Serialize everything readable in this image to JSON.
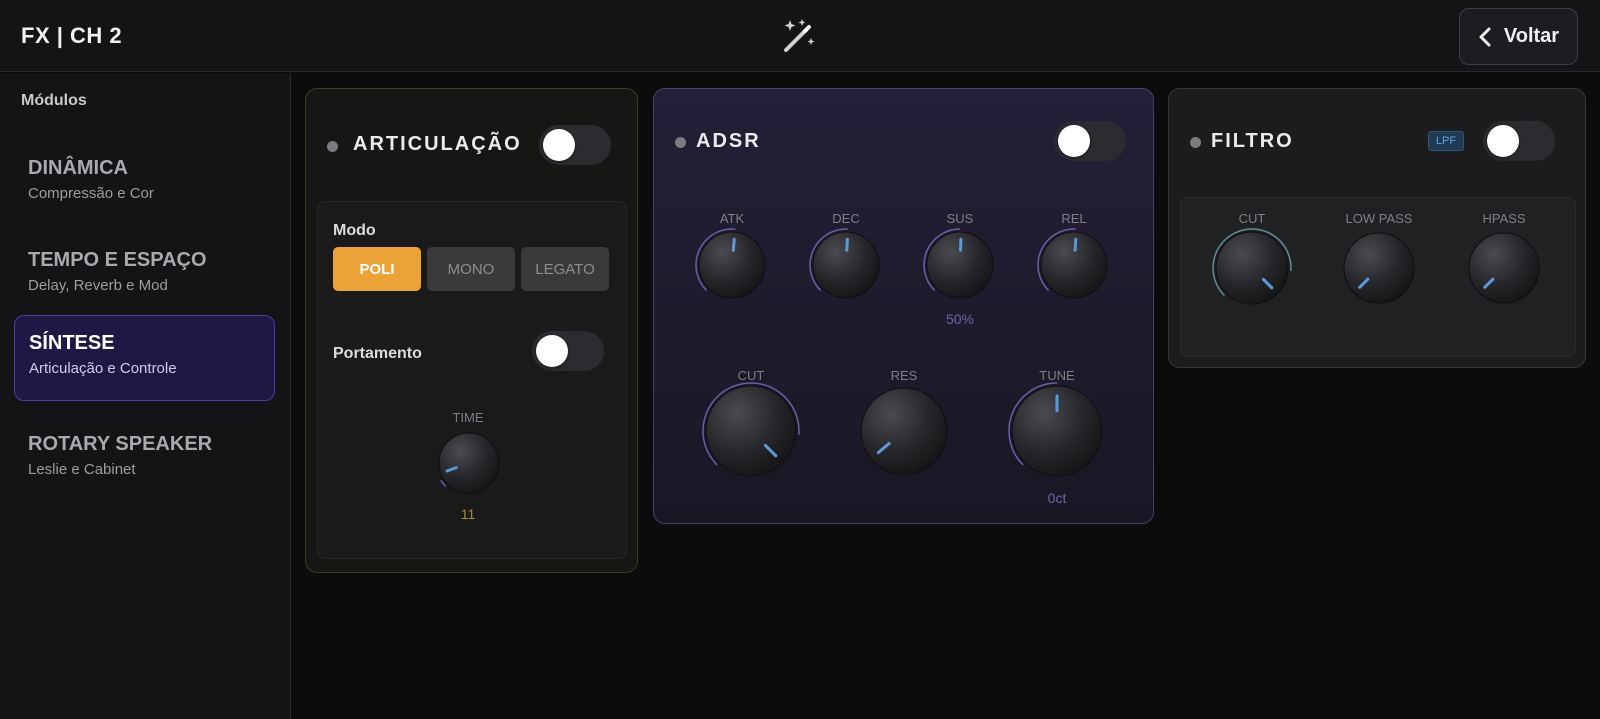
{
  "header": {
    "title": "FX | CH 2",
    "back_label": "Voltar"
  },
  "sidebar": {
    "heading": "Módulos",
    "items": [
      {
        "label": "DINÂMICA",
        "sub": "Compressão e Cor",
        "active": false
      },
      {
        "label": "TEMPO E ESPAÇO",
        "sub": "Delay, Reverb e Mod",
        "active": false
      },
      {
        "label": "SÍNTESE",
        "sub": "Articulação e Controle",
        "active": true
      },
      {
        "label": "ROTARY SPEAKER",
        "sub": "Leslie e Cabinet",
        "active": false
      }
    ]
  },
  "articulacao": {
    "title": "ARTICULAÇÃO",
    "enabled": false,
    "modo_label": "Modo",
    "modes": [
      "POLI",
      "MONO",
      "LEGATO"
    ],
    "selected_mode": "POLI",
    "portamento_label": "Portamento",
    "portamento_enabled": false,
    "time": {
      "label": "TIME",
      "value": "11"
    }
  },
  "adsr": {
    "title": "ADSR",
    "enabled": false,
    "knobs": [
      {
        "label": "ATK",
        "value": ""
      },
      {
        "label": "DEC",
        "value": ""
      },
      {
        "label": "SUS",
        "value": "50%"
      },
      {
        "label": "REL",
        "value": ""
      }
    ],
    "knobs_bottom": [
      {
        "label": "CUT",
        "value": ""
      },
      {
        "label": "RES",
        "value": ""
      },
      {
        "label": "TUNE",
        "value": "0ct"
      }
    ]
  },
  "filtro": {
    "title": "FILTRO",
    "badge": "LPF",
    "enabled": false,
    "knobs": [
      {
        "label": "CUT"
      },
      {
        "label": "LOW PASS"
      },
      {
        "label": "HPASS"
      }
    ]
  },
  "colors": {
    "accent_orange": "#eba338",
    "accent_purple": "#4a3ca0",
    "knob_indicator": "#5a9ad6"
  },
  "icons": {
    "header_center": "magic-wand-icon",
    "back": "chevron-left-icon"
  }
}
